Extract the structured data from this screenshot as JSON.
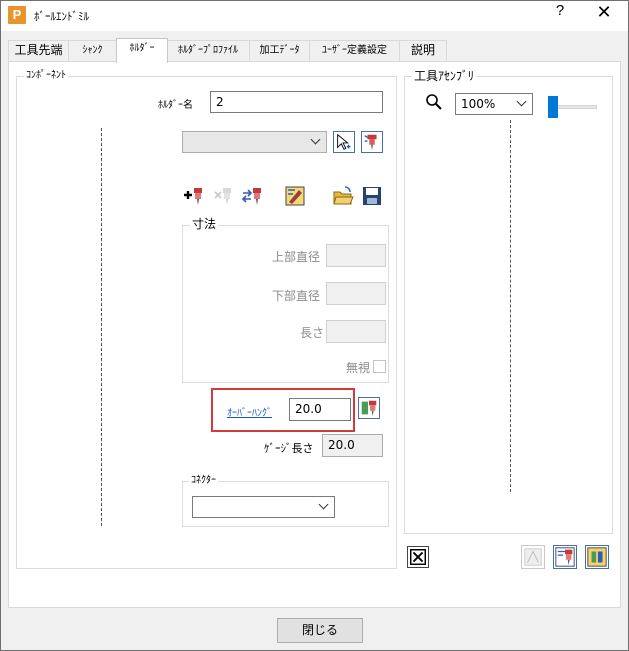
{
  "window": {
    "app_icon": "P",
    "title": "ﾎﾞｰﾙｴﾝﾄﾞﾐﾙ",
    "help": "?",
    "close": "✕"
  },
  "tabs": [
    {
      "label": "工具先端"
    },
    {
      "label": "ｼｬﾝｸ"
    },
    {
      "label": "ﾎﾙﾀﾞｰ",
      "active": true
    },
    {
      "label": "ﾎﾙﾀﾞｰﾌﾟﾛﾌｧｲﾙ"
    },
    {
      "label": "加工ﾃﾞｰﾀ"
    },
    {
      "label": "ﾕｰｻﾞｰ定義設定"
    },
    {
      "label": "説明"
    }
  ],
  "component": {
    "group_label": "ｺﾝﾎﾟｰﾈﾝﾄ",
    "holder_name_label": "ﾎﾙﾀﾞｰ名",
    "holder_name_value": "2",
    "dimensions": {
      "group_label": "寸法",
      "top_diameter_label": "上部直径",
      "bottom_diameter_label": "下部直径",
      "length_label": "長さ",
      "ignore_label": "無視"
    },
    "overhang_label": "ｵｰﾊﾞｰﾊﾝｸﾞ",
    "overhang_value": "20.0",
    "gauge_length_label": "ｹﾞｰｼﾞ長さ",
    "gauge_length_value": "20.0",
    "connector_label": "ｺﾈｸﾀｰ"
  },
  "assembly": {
    "group_label": "工具ｱｾﾝﾌﾞﾘ",
    "zoom_value": "100%"
  },
  "footer": {
    "close_label": "閉じる"
  }
}
